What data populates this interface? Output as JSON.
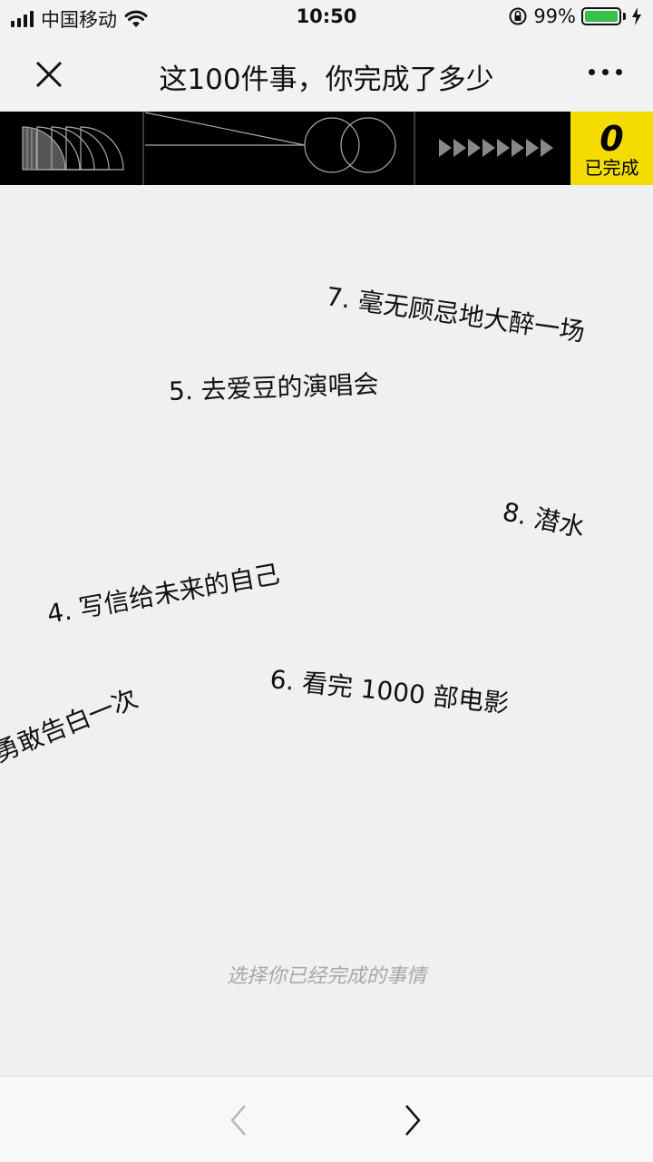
{
  "status_bar": {
    "carrier": "中国移动",
    "time": "10:50",
    "battery_percent": "99%",
    "battery_level": 0.99,
    "battery_color": "#35c24a"
  },
  "nav": {
    "title": "这100件事，你完成了多少"
  },
  "banner": {
    "completed_count": "0",
    "completed_label": "已完成",
    "accent_color": "#f5dc00"
  },
  "items": [
    {
      "text": "7. 毫无顾忌地大醉一场"
    },
    {
      "text": "5. 去爱豆的演唱会"
    },
    {
      "text": "8. 潜水"
    },
    {
      "text": "4. 写信给未来的自己"
    },
    {
      "text": "6. 看完 1000 部电影"
    },
    {
      "text": "勇敢告白一次"
    }
  ],
  "hint": "选择你已经完成的事情",
  "icons": {
    "close": "close-icon",
    "more": "more-icon",
    "back": "chevron-left-icon",
    "forward": "chevron-right-icon"
  }
}
